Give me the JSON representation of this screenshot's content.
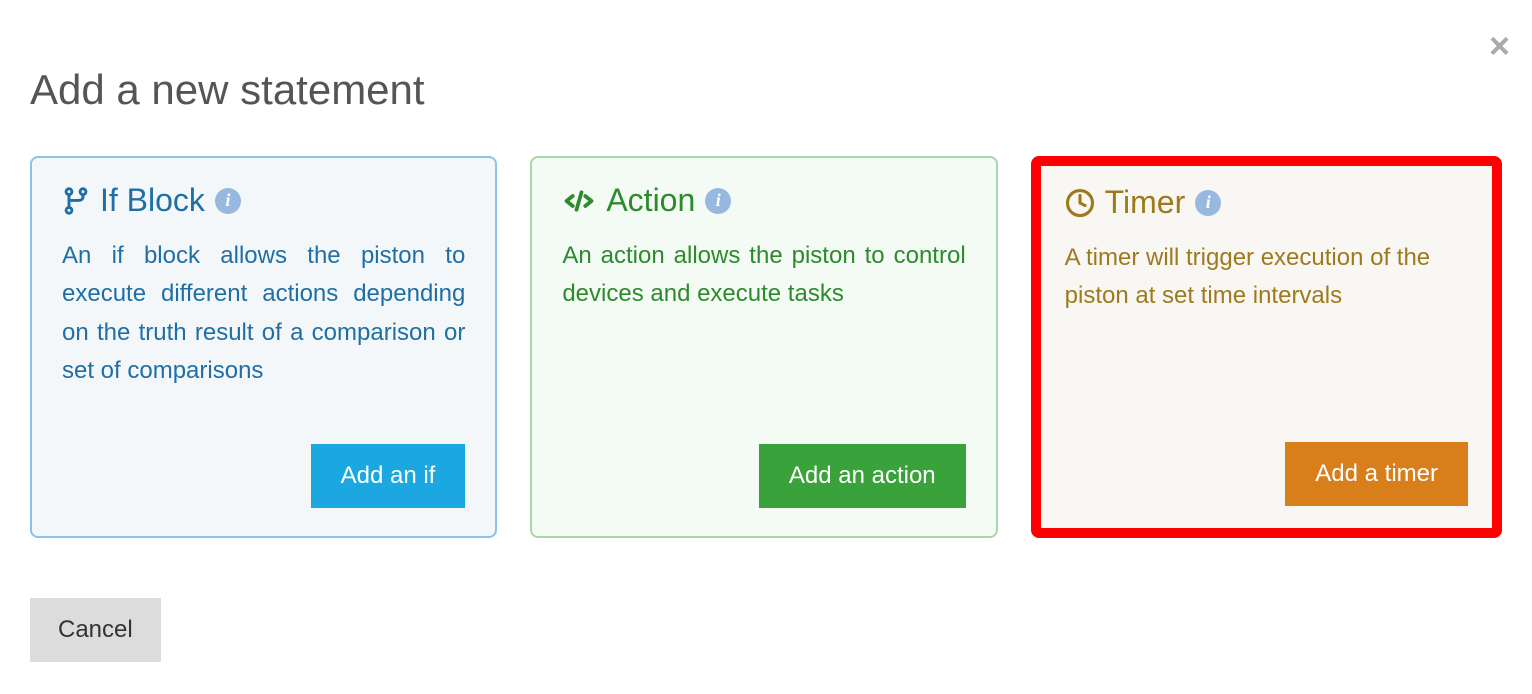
{
  "modal": {
    "title": "Add a new statement",
    "close": "×",
    "cancel_label": "Cancel"
  },
  "cards": {
    "if": {
      "title": "If Block",
      "description": "An if block allows the piston to execute different actions depending on the truth result of a comparison or set of comparisons",
      "button_label": "Add an if",
      "info": "i"
    },
    "action": {
      "title": "Action",
      "description": "An action allows the piston to control devices and execute tasks",
      "button_label": "Add an action",
      "info": "i"
    },
    "timer": {
      "title": "Timer",
      "description": "A timer will trigger execution of the piston at set time intervals",
      "button_label": "Add a timer",
      "info": "i"
    }
  }
}
